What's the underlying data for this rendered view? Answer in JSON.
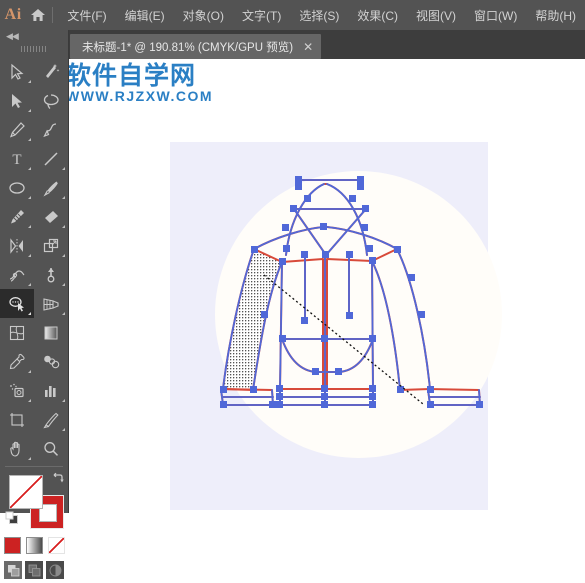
{
  "app": {
    "name": "Ai",
    "logo_color": "#d4956a",
    "menubar_bg": "#535353"
  },
  "menu": {
    "home_icon": "home-icon",
    "items": [
      {
        "label": "文件(F)",
        "name": "menu-file"
      },
      {
        "label": "编辑(E)",
        "name": "menu-edit"
      },
      {
        "label": "对象(O)",
        "name": "menu-object"
      },
      {
        "label": "文字(T)",
        "name": "menu-type"
      },
      {
        "label": "选择(S)",
        "name": "menu-select"
      },
      {
        "label": "效果(C)",
        "name": "menu-effect"
      },
      {
        "label": "视图(V)",
        "name": "menu-view"
      },
      {
        "label": "窗口(W)",
        "name": "menu-window"
      },
      {
        "label": "帮助(H)",
        "name": "menu-help"
      }
    ]
  },
  "tab": {
    "title": "未标题-1* @ 190.81% (CMYK/GPU 预览)",
    "document_name": "未标题-1*",
    "zoom": "190.81%",
    "color_mode": "CMYK/GPU 预览",
    "close_label": "✕"
  },
  "toolbar": {
    "collapse_label": "◀◀",
    "selected_tool": "shaper-tool",
    "tools": [
      {
        "name": "selection-tool",
        "label": "选择工具"
      },
      {
        "name": "magic-wand-tool",
        "label": "魔棒工具"
      },
      {
        "name": "direct-selection-tool",
        "label": "直接选择工具"
      },
      {
        "name": "lasso-tool",
        "label": "套索工具"
      },
      {
        "name": "pen-tool",
        "label": "钢笔工具"
      },
      {
        "name": "curvature-tool",
        "label": "曲率工具"
      },
      {
        "name": "type-tool",
        "label": "文字工具"
      },
      {
        "name": "line-segment-tool",
        "label": "直线段工具"
      },
      {
        "name": "ellipse-tool",
        "label": "椭圆工具"
      },
      {
        "name": "paintbrush-tool",
        "label": "画笔工具"
      },
      {
        "name": "pencil-tool",
        "label": "铅笔工具"
      },
      {
        "name": "eraser-tool",
        "label": "橡皮擦工具"
      },
      {
        "name": "rotate-tool",
        "label": "旋转工具"
      },
      {
        "name": "scale-tool",
        "label": "比例缩放工具"
      },
      {
        "name": "width-tool",
        "label": "宽度工具"
      },
      {
        "name": "free-transform-tool",
        "label": "自由变换工具"
      },
      {
        "name": "shaper-tool",
        "label": "Shaper 工具"
      },
      {
        "name": "perspective-grid-tool",
        "label": "透视网格工具"
      },
      {
        "name": "mesh-tool",
        "label": "网格工具"
      },
      {
        "name": "gradient-tool",
        "label": "渐变工具"
      },
      {
        "name": "eyedropper-tool",
        "label": "吸管工具"
      },
      {
        "name": "blend-tool",
        "label": "混合工具"
      },
      {
        "name": "symbol-sprayer-tool",
        "label": "符号喷枪工具"
      },
      {
        "name": "column-graph-tool",
        "label": "柱形图工具"
      },
      {
        "name": "artboard-tool",
        "label": "画板工具"
      },
      {
        "name": "slice-tool",
        "label": "切片工具"
      },
      {
        "name": "hand-tool",
        "label": "抓手工具"
      },
      {
        "name": "zoom-tool",
        "label": "缩放工具"
      }
    ],
    "fill": {
      "name": "fill-swatch",
      "value": "none",
      "color": "#ffffff"
    },
    "stroke": {
      "name": "stroke-swatch",
      "value": "red",
      "color": "#cc2222"
    },
    "swap_icon": "swap-fill-stroke-icon",
    "defaults_icon": "default-fill-stroke-icon",
    "paint_modes": [
      {
        "name": "color-mode-swatch",
        "label": "颜色",
        "color": "#cc2222",
        "active": false
      },
      {
        "name": "gradient-mode-swatch",
        "label": "渐变",
        "color": "#9a9a9a",
        "active": false
      },
      {
        "name": "none-mode-swatch",
        "label": "无",
        "color": "#ffffff",
        "active": true
      }
    ],
    "screen_modes": [
      {
        "name": "drawing-normal-mode",
        "label": "正常绘图",
        "active": true
      },
      {
        "name": "drawing-behind-mode",
        "label": "背面绘图",
        "active": false
      },
      {
        "name": "drawing-inside-mode",
        "label": "内部绘图",
        "active": false
      }
    ]
  },
  "canvas": {
    "background": "#ffffff",
    "artboard_color": "#eeeefa",
    "circle_color": "#fffdf9",
    "artwork_name": "hoodie-jacket-vector",
    "path_stroke_color": "#d84a3a",
    "selection_color": "#5068d8",
    "anchor_color": "#5068d8",
    "marquee_label": "lasso-selection-path"
  },
  "watermark": {
    "title": "软件自学网",
    "url": "WWW.RJZXW.COM",
    "color": "#2a7fc4"
  }
}
